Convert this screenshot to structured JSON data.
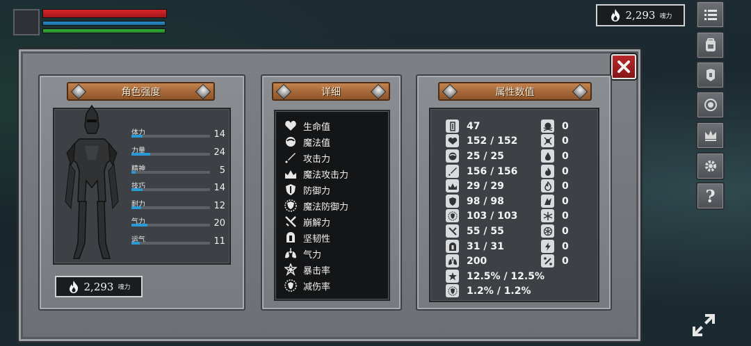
{
  "hud": {
    "currency_value": "2,293",
    "currency_unit": "魂力"
  },
  "dialog": {
    "panels": {
      "character": {
        "title": "角色强度"
      },
      "details": {
        "title": "详细"
      },
      "attributes": {
        "title": "属性数值"
      }
    },
    "stats": [
      {
        "label": "体力",
        "value": "14",
        "fill": 0.14
      },
      {
        "label": "力量",
        "value": "24",
        "fill": 0.24
      },
      {
        "label": "精神",
        "value": "5",
        "fill": 0.05
      },
      {
        "label": "技巧",
        "value": "14",
        "fill": 0.14
      },
      {
        "label": "耐力",
        "value": "12",
        "fill": 0.12
      },
      {
        "label": "气力",
        "value": "20",
        "fill": 0.2
      },
      {
        "label": "运气",
        "value": "11",
        "fill": 0.11
      }
    ],
    "panel_currency_value": "2,293",
    "panel_currency_unit": "魂力",
    "details": [
      {
        "label": "生命值",
        "icon": "heart-icon"
      },
      {
        "label": "魔法值",
        "icon": "mana-icon"
      },
      {
        "label": "攻击力",
        "icon": "sword-icon"
      },
      {
        "label": "魔法攻击力",
        "icon": "magic-attack-icon"
      },
      {
        "label": "防御力",
        "icon": "shield-icon"
      },
      {
        "label": "魔法防御力",
        "icon": "magic-defense-icon"
      },
      {
        "label": "崩解力",
        "icon": "break-icon"
      },
      {
        "label": "坚韧性",
        "icon": "helmet-icon"
      },
      {
        "label": "气力",
        "icon": "lungs-icon"
      },
      {
        "label": "暴击率",
        "icon": "critical-star-icon"
      },
      {
        "label": "减伤率",
        "icon": "damage-reduction-icon"
      }
    ],
    "attributes_left": [
      {
        "value": "47",
        "icon": "level-icon"
      },
      {
        "value": "152 / 152",
        "icon": "heart-icon"
      },
      {
        "value": "25 / 25",
        "icon": "mana-icon"
      },
      {
        "value": "156 / 156",
        "icon": "sword-icon"
      },
      {
        "value": "29 / 29",
        "icon": "magic-attack-icon"
      },
      {
        "value": "98 / 98",
        "icon": "shield-icon"
      },
      {
        "value": "103 / 103",
        "icon": "magic-defense-icon"
      },
      {
        "value": "55 / 55",
        "icon": "break-icon"
      },
      {
        "value": "31 / 31",
        "icon": "helmet-icon"
      },
      {
        "value": "200",
        "icon": "lungs-icon"
      },
      {
        "value": "12.5% / 12.5%",
        "icon": "critical-star-icon"
      },
      {
        "value": "1.2% / 1.2%",
        "icon": "damage-reduction-icon"
      }
    ],
    "attributes_right": [
      {
        "value": "0",
        "icon": "skull-icon"
      },
      {
        "value": "0",
        "icon": "poison-icon"
      },
      {
        "value": "0",
        "icon": "bleed-icon"
      },
      {
        "value": "0",
        "icon": "burn-icon"
      },
      {
        "value": "0",
        "icon": "fire-icon"
      },
      {
        "value": "0",
        "icon": "curse-icon"
      },
      {
        "value": "0",
        "icon": "frost-icon"
      },
      {
        "value": "0",
        "icon": "freeze-icon"
      },
      {
        "value": "0",
        "icon": "lightning-icon"
      },
      {
        "value": "0",
        "icon": "stun-icon"
      }
    ]
  },
  "menu": [
    {
      "name": "menu-list-icon"
    },
    {
      "name": "backpack-icon"
    },
    {
      "name": "armor-icon"
    },
    {
      "name": "skill-icon"
    },
    {
      "name": "crown-icon"
    },
    {
      "name": "settings-gear-icon"
    },
    {
      "name": "help-icon"
    }
  ]
}
